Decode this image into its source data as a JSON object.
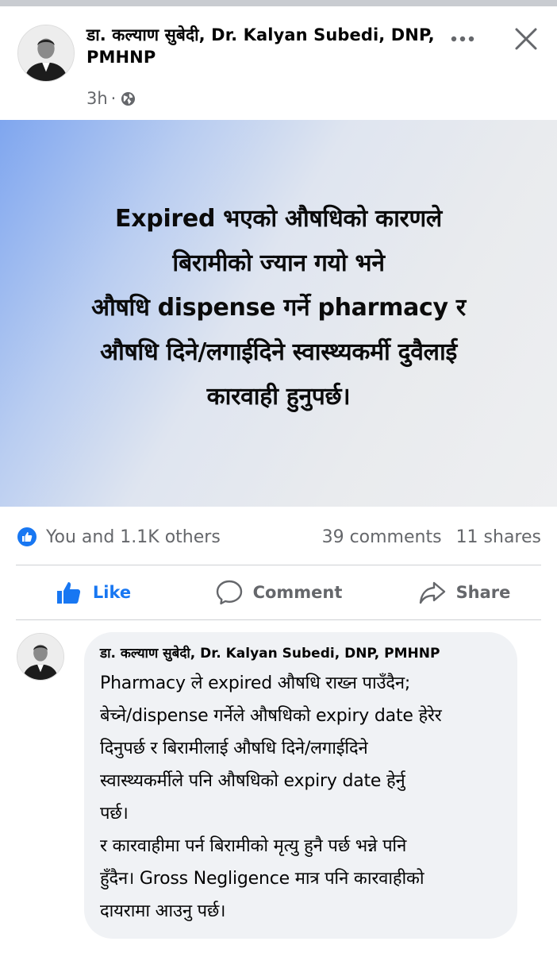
{
  "post": {
    "author": "डा. कल्याण सुबेदी, Dr. Kalyan Subedi, DNP, PMHNP",
    "time": "3h",
    "separator": "·",
    "visibility_icon": "globe-icon",
    "image_text": "Expired भएको औषधिको कारणले\nबिरामीको ज्यान गयो भने\nऔषधि dispense गर्ने pharmacy र\nऔषधि दिने/लगाईदिने स्वास्थ्यकर्मी दुवैलाई\nकारवाही हुनुपर्छ।"
  },
  "reactions": {
    "summary": "You and 1.1K others",
    "comments": "39 comments",
    "shares": "11 shares"
  },
  "actions": {
    "like": "Like",
    "comment": "Comment",
    "share": "Share"
  },
  "comment": {
    "author": "डा. कल्याण सुबेदी, Dr. Kalyan Subedi, DNP, PMHNP",
    "text": "Pharmacy ले expired औषधि राख्न पाउँदैन;\nबेच्ने/dispense गर्नेले औषधिको expiry date हेरेर\nदिनुपर्छ र  बिरामीलाई औषधि दिने/लगाईदिने\nस्वास्थ्यकर्मीले पनि औषधिको expiry date हेर्नु\nपर्छ।\nर कारवाहीमा पर्न बिरामीको मृत्यु हुनै पर्छ भन्ने पनि\nहुँदैन। Gross Negligence मात्र पनि कारवाहीको\nदायरामा आउनु पर्छ।"
  },
  "colors": {
    "accent": "#1877f2",
    "secondary_text": "#65676b",
    "bubble_bg": "#f0f2f5"
  }
}
